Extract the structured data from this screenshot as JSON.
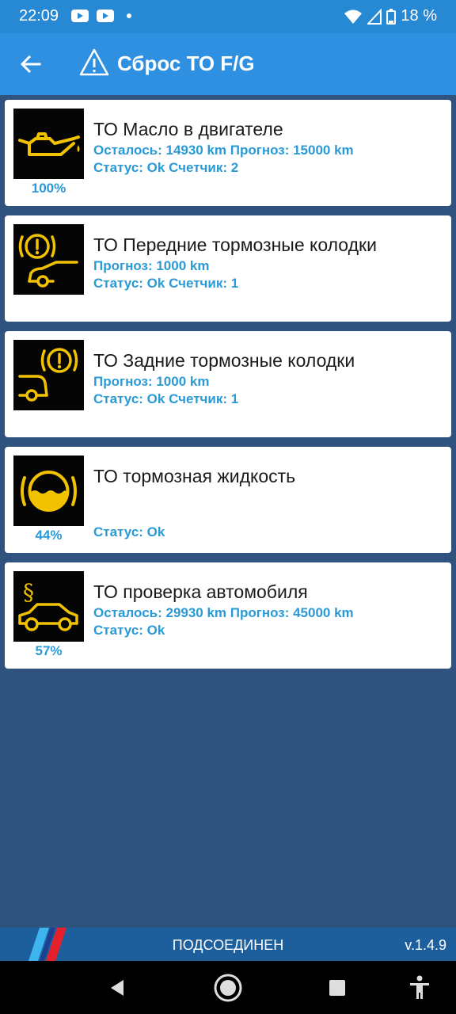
{
  "status_bar": {
    "time": "22:09",
    "battery": "18 %",
    "icons": [
      "youtube-icon",
      "youtube-icon",
      "notification-dot",
      "wifi-icon",
      "signal-icon",
      "battery-icon"
    ]
  },
  "app_bar": {
    "title": "Сброс ТО F/G",
    "back_icon": "arrow-left-icon",
    "title_icon": "warning-triangle-icon"
  },
  "items": [
    {
      "icon": "oil-can-icon",
      "title": "ТО Масло в двигателе",
      "line1": "Осталось: 14930 km Прогноз: 15000 km",
      "line2": "Статус: Ok Счетчик: 2",
      "percent": "100%"
    },
    {
      "icon": "front-brake-pads-icon",
      "title": "ТО Передние тормозные колодки",
      "line1": "Прогноз: 1000 km",
      "line2": "Статус: Ok Счетчик: 1",
      "percent": ""
    },
    {
      "icon": "rear-brake-pads-icon",
      "title": "ТО Задние тормозные колодки",
      "line1": "Прогноз: 1000 km",
      "line2": "Статус: Ok Счетчик: 1",
      "percent": ""
    },
    {
      "icon": "brake-fluid-icon",
      "title": "ТО тормозная жидкость",
      "line1": "",
      "line2": "Статус: Ok",
      "percent": "44%"
    },
    {
      "icon": "vehicle-inspection-icon",
      "title": "ТО проверка автомобиля",
      "line1": "Осталось: 29930 km Прогноз: 45000 km",
      "line2": "Статус: Ok",
      "percent": "57%"
    }
  ],
  "bottom_status": {
    "connection": "ПОДСОЕДИНЕН",
    "version": "v.1.4.9"
  },
  "nav_bar": {
    "buttons": [
      "back-triangle-icon",
      "home-circle-icon",
      "recents-square-icon",
      "accessibility-icon"
    ]
  },
  "colors": {
    "status_bar": "#2788d4",
    "app_bar": "#2f8fe0",
    "background": "#2f527f",
    "accent_text": "#2a9ad6",
    "icon_yellow": "#f2c200"
  }
}
